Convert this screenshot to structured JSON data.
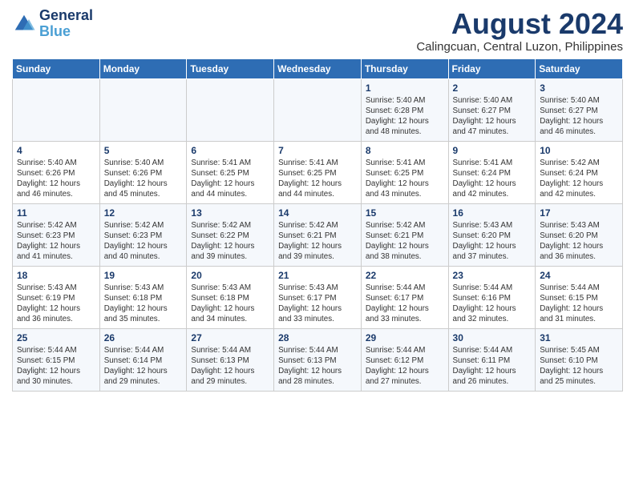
{
  "header": {
    "logo_line1": "General",
    "logo_line2": "Blue",
    "title": "August 2024",
    "subtitle": "Calingcuan, Central Luzon, Philippines"
  },
  "columns": [
    "Sunday",
    "Monday",
    "Tuesday",
    "Wednesday",
    "Thursday",
    "Friday",
    "Saturday"
  ],
  "weeks": [
    [
      {
        "day": "",
        "info": ""
      },
      {
        "day": "",
        "info": ""
      },
      {
        "day": "",
        "info": ""
      },
      {
        "day": "",
        "info": ""
      },
      {
        "day": "1",
        "info": "Sunrise: 5:40 AM\nSunset: 6:28 PM\nDaylight: 12 hours\nand 48 minutes."
      },
      {
        "day": "2",
        "info": "Sunrise: 5:40 AM\nSunset: 6:27 PM\nDaylight: 12 hours\nand 47 minutes."
      },
      {
        "day": "3",
        "info": "Sunrise: 5:40 AM\nSunset: 6:27 PM\nDaylight: 12 hours\nand 46 minutes."
      }
    ],
    [
      {
        "day": "4",
        "info": "Sunrise: 5:40 AM\nSunset: 6:26 PM\nDaylight: 12 hours\nand 46 minutes."
      },
      {
        "day": "5",
        "info": "Sunrise: 5:40 AM\nSunset: 6:26 PM\nDaylight: 12 hours\nand 45 minutes."
      },
      {
        "day": "6",
        "info": "Sunrise: 5:41 AM\nSunset: 6:25 PM\nDaylight: 12 hours\nand 44 minutes."
      },
      {
        "day": "7",
        "info": "Sunrise: 5:41 AM\nSunset: 6:25 PM\nDaylight: 12 hours\nand 44 minutes."
      },
      {
        "day": "8",
        "info": "Sunrise: 5:41 AM\nSunset: 6:25 PM\nDaylight: 12 hours\nand 43 minutes."
      },
      {
        "day": "9",
        "info": "Sunrise: 5:41 AM\nSunset: 6:24 PM\nDaylight: 12 hours\nand 42 minutes."
      },
      {
        "day": "10",
        "info": "Sunrise: 5:42 AM\nSunset: 6:24 PM\nDaylight: 12 hours\nand 42 minutes."
      }
    ],
    [
      {
        "day": "11",
        "info": "Sunrise: 5:42 AM\nSunset: 6:23 PM\nDaylight: 12 hours\nand 41 minutes."
      },
      {
        "day": "12",
        "info": "Sunrise: 5:42 AM\nSunset: 6:23 PM\nDaylight: 12 hours\nand 40 minutes."
      },
      {
        "day": "13",
        "info": "Sunrise: 5:42 AM\nSunset: 6:22 PM\nDaylight: 12 hours\nand 39 minutes."
      },
      {
        "day": "14",
        "info": "Sunrise: 5:42 AM\nSunset: 6:21 PM\nDaylight: 12 hours\nand 39 minutes."
      },
      {
        "day": "15",
        "info": "Sunrise: 5:42 AM\nSunset: 6:21 PM\nDaylight: 12 hours\nand 38 minutes."
      },
      {
        "day": "16",
        "info": "Sunrise: 5:43 AM\nSunset: 6:20 PM\nDaylight: 12 hours\nand 37 minutes."
      },
      {
        "day": "17",
        "info": "Sunrise: 5:43 AM\nSunset: 6:20 PM\nDaylight: 12 hours\nand 36 minutes."
      }
    ],
    [
      {
        "day": "18",
        "info": "Sunrise: 5:43 AM\nSunset: 6:19 PM\nDaylight: 12 hours\nand 36 minutes."
      },
      {
        "day": "19",
        "info": "Sunrise: 5:43 AM\nSunset: 6:18 PM\nDaylight: 12 hours\nand 35 minutes."
      },
      {
        "day": "20",
        "info": "Sunrise: 5:43 AM\nSunset: 6:18 PM\nDaylight: 12 hours\nand 34 minutes."
      },
      {
        "day": "21",
        "info": "Sunrise: 5:43 AM\nSunset: 6:17 PM\nDaylight: 12 hours\nand 33 minutes."
      },
      {
        "day": "22",
        "info": "Sunrise: 5:44 AM\nSunset: 6:17 PM\nDaylight: 12 hours\nand 33 minutes."
      },
      {
        "day": "23",
        "info": "Sunrise: 5:44 AM\nSunset: 6:16 PM\nDaylight: 12 hours\nand 32 minutes."
      },
      {
        "day": "24",
        "info": "Sunrise: 5:44 AM\nSunset: 6:15 PM\nDaylight: 12 hours\nand 31 minutes."
      }
    ],
    [
      {
        "day": "25",
        "info": "Sunrise: 5:44 AM\nSunset: 6:15 PM\nDaylight: 12 hours\nand 30 minutes."
      },
      {
        "day": "26",
        "info": "Sunrise: 5:44 AM\nSunset: 6:14 PM\nDaylight: 12 hours\nand 29 minutes."
      },
      {
        "day": "27",
        "info": "Sunrise: 5:44 AM\nSunset: 6:13 PM\nDaylight: 12 hours\nand 29 minutes."
      },
      {
        "day": "28",
        "info": "Sunrise: 5:44 AM\nSunset: 6:13 PM\nDaylight: 12 hours\nand 28 minutes."
      },
      {
        "day": "29",
        "info": "Sunrise: 5:44 AM\nSunset: 6:12 PM\nDaylight: 12 hours\nand 27 minutes."
      },
      {
        "day": "30",
        "info": "Sunrise: 5:44 AM\nSunset: 6:11 PM\nDaylight: 12 hours\nand 26 minutes."
      },
      {
        "day": "31",
        "info": "Sunrise: 5:45 AM\nSunset: 6:10 PM\nDaylight: 12 hours\nand 25 minutes."
      }
    ]
  ]
}
